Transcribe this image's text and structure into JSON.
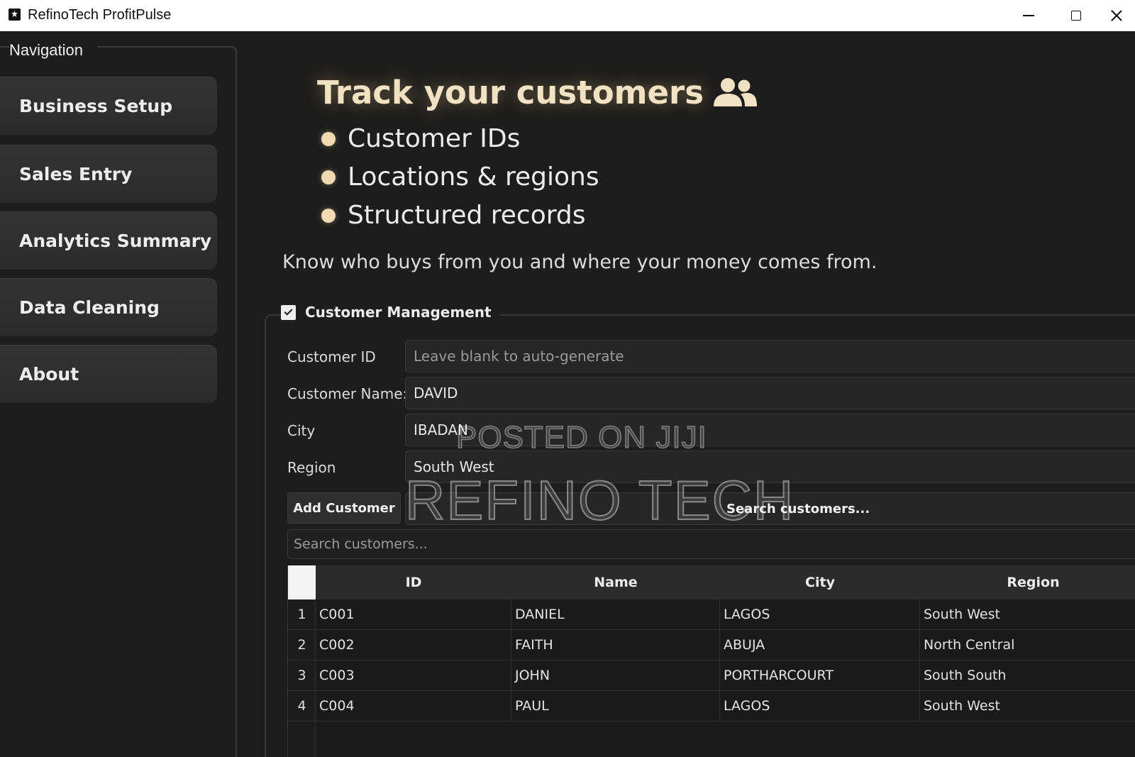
{
  "window": {
    "title": "RefinoTech ProfitPulse"
  },
  "sidebar": {
    "legend": "Navigation",
    "items": [
      {
        "label": "Business Setup"
      },
      {
        "label": "Sales Entry"
      },
      {
        "label": "Analytics Summary"
      },
      {
        "label": "Data Cleaning"
      },
      {
        "label": "About"
      }
    ]
  },
  "hero": {
    "title": "Track your customers",
    "icon": "users-icon",
    "bullets": [
      "Customer IDs",
      "Locations & regions",
      "Structured records"
    ],
    "tagline": "Know who buys from you and where your money comes from."
  },
  "customer_management": {
    "title": "Customer Management",
    "checked": true,
    "fields": {
      "customer_id": {
        "label": "Customer ID",
        "value": "",
        "placeholder": "Leave blank to auto-generate"
      },
      "customer_name": {
        "label": "Customer Name:",
        "value": "DAVID"
      },
      "city": {
        "label": "City",
        "value": "IBADAN"
      },
      "region": {
        "label": "Region",
        "value": "South West"
      }
    },
    "add_button": "Add Customer",
    "search_top_placeholder": "Search customers...",
    "search_bottom_placeholder": "Search customers..."
  },
  "table": {
    "columns": [
      "ID",
      "Name",
      "City",
      "Region"
    ],
    "rows": [
      {
        "num": "1",
        "id": "C001",
        "name": "DANIEL",
        "city": "LAGOS",
        "region": "South West"
      },
      {
        "num": "2",
        "id": "C002",
        "name": "FAITH",
        "city": "ABUJA",
        "region": "North Central"
      },
      {
        "num": "3",
        "id": "C003",
        "name": "JOHN",
        "city": "PORTHARCOURT",
        "region": "South South"
      },
      {
        "num": "4",
        "id": "C004",
        "name": "PAUL",
        "city": "LAGOS",
        "region": "South West"
      }
    ]
  },
  "watermarks": {
    "line1": "POSTED ON JIJI",
    "line2": "REFINO TECH"
  },
  "colors": {
    "background": "#1d1d1d",
    "hero_title": "#f1e2c4",
    "bullet": "#f1d9b0"
  }
}
